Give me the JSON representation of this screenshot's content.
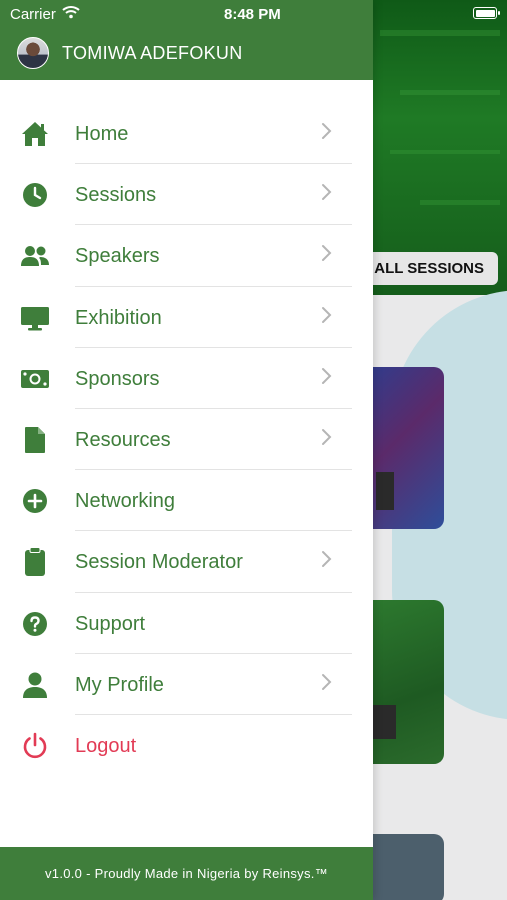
{
  "status_bar": {
    "carrier": "Carrier",
    "time": "8:48 PM"
  },
  "background": {
    "all_sessions_label": "ALL SESSIONS"
  },
  "drawer": {
    "user_name": "TOMIWA ADEFOKUN",
    "menu": [
      {
        "label": "Home",
        "icon": "home-icon",
        "has_chevron": true
      },
      {
        "label": "Sessions",
        "icon": "clock-icon",
        "has_chevron": true
      },
      {
        "label": "Speakers",
        "icon": "users-icon",
        "has_chevron": true
      },
      {
        "label": "Exhibition",
        "icon": "monitor-icon",
        "has_chevron": true
      },
      {
        "label": "Sponsors",
        "icon": "money-icon",
        "has_chevron": true
      },
      {
        "label": "Resources",
        "icon": "document-icon",
        "has_chevron": true
      },
      {
        "label": "Networking",
        "icon": "plus-circle-icon",
        "has_chevron": false
      },
      {
        "label": "Session Moderator",
        "icon": "clipboard-icon",
        "has_chevron": true
      },
      {
        "label": "Support",
        "icon": "question-circle-icon",
        "has_chevron": false
      },
      {
        "label": "My Profile",
        "icon": "user-icon",
        "has_chevron": true
      },
      {
        "label": "Logout",
        "icon": "power-icon",
        "has_chevron": false
      }
    ],
    "footer": "v1.0.0 - Proudly Made in Nigeria by Reinsys.™"
  },
  "colors": {
    "primary_green": "#3f7e3b",
    "logout_red": "#e23b55",
    "divider": "#e3e3e3"
  }
}
